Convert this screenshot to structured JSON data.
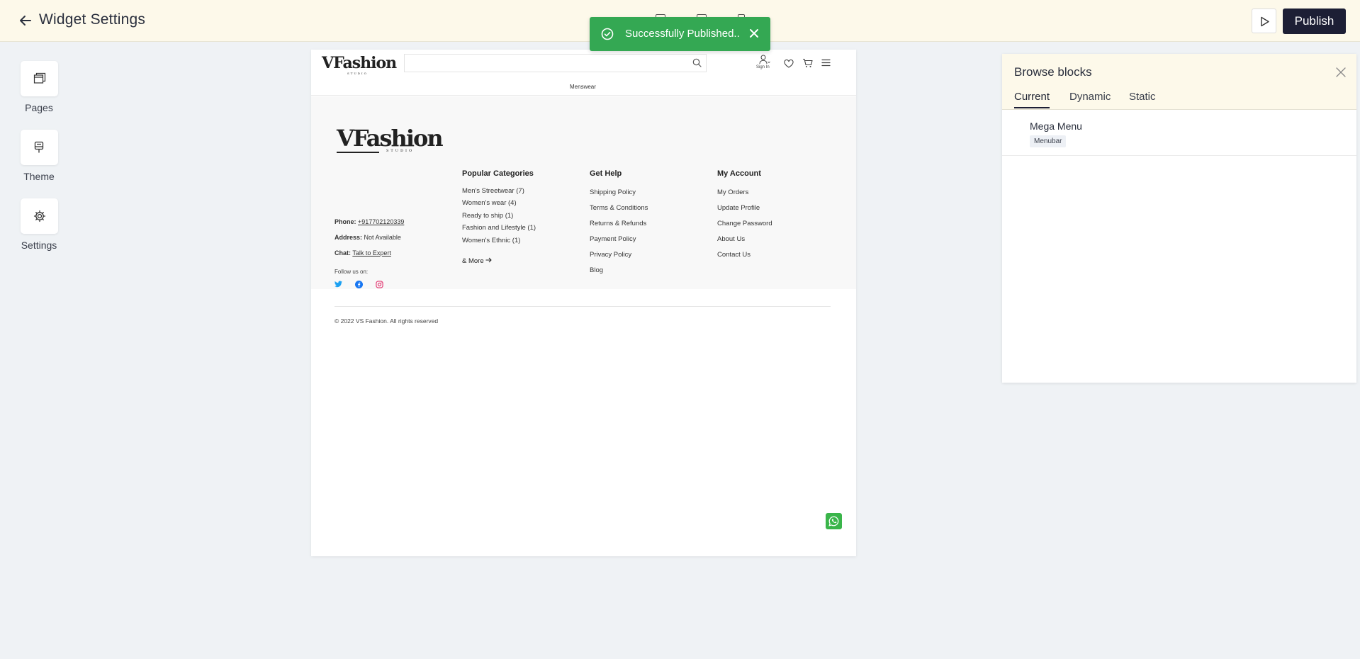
{
  "topbar": {
    "title": "Widget Settings",
    "publish_label": "Publish"
  },
  "toast": {
    "message": "Successfully Published..",
    "color": "#34a853"
  },
  "sidebar": {
    "items": [
      {
        "label": "Pages",
        "icon": "pages-icon"
      },
      {
        "label": "Theme",
        "icon": "theme-icon"
      },
      {
        "label": "Settings",
        "icon": "gear-icon"
      }
    ]
  },
  "site": {
    "logo": "VFashion",
    "logo_sub": "STUDIO",
    "search_placeholder": "",
    "signin_label": "Sign In",
    "menu_item": "Menswear",
    "footer": {
      "logo": "VFashion",
      "logo_sub": "STUDIO",
      "phone_label": "Phone:",
      "phone_value": "+917702120339",
      "address_label": "Address:",
      "address_value": "Not Available",
      "chat_label": "Chat:",
      "chat_value": "Talk to Expert",
      "follow_label": "Follow us on:",
      "columns": [
        {
          "title": "Popular Categories",
          "items": [
            "Men's Streetwear (7)",
            "Women's wear (4)",
            "Ready to ship (1)",
            "Fashion and Lifestyle (1)",
            "Women's Ethnic (1)"
          ]
        },
        {
          "title": "Get Help",
          "items": [
            "Shipping Policy",
            "Terms & Conditions",
            "Returns & Refunds",
            "Payment Policy",
            "Privacy Policy",
            "Blog"
          ]
        },
        {
          "title": "My Account",
          "items": [
            "My Orders",
            "Update Profile",
            "Change Password",
            "About Us",
            "Contact Us"
          ]
        }
      ],
      "more_label": "& More",
      "copyright": "© 2022 VS Fashion. All rights reserved"
    }
  },
  "panel": {
    "title": "Browse blocks",
    "tabs": [
      "Current",
      "Dynamic",
      "Static"
    ],
    "active_tab": "Current",
    "blocks": [
      {
        "name": "Mega Menu",
        "tag": "Menubar"
      }
    ]
  }
}
